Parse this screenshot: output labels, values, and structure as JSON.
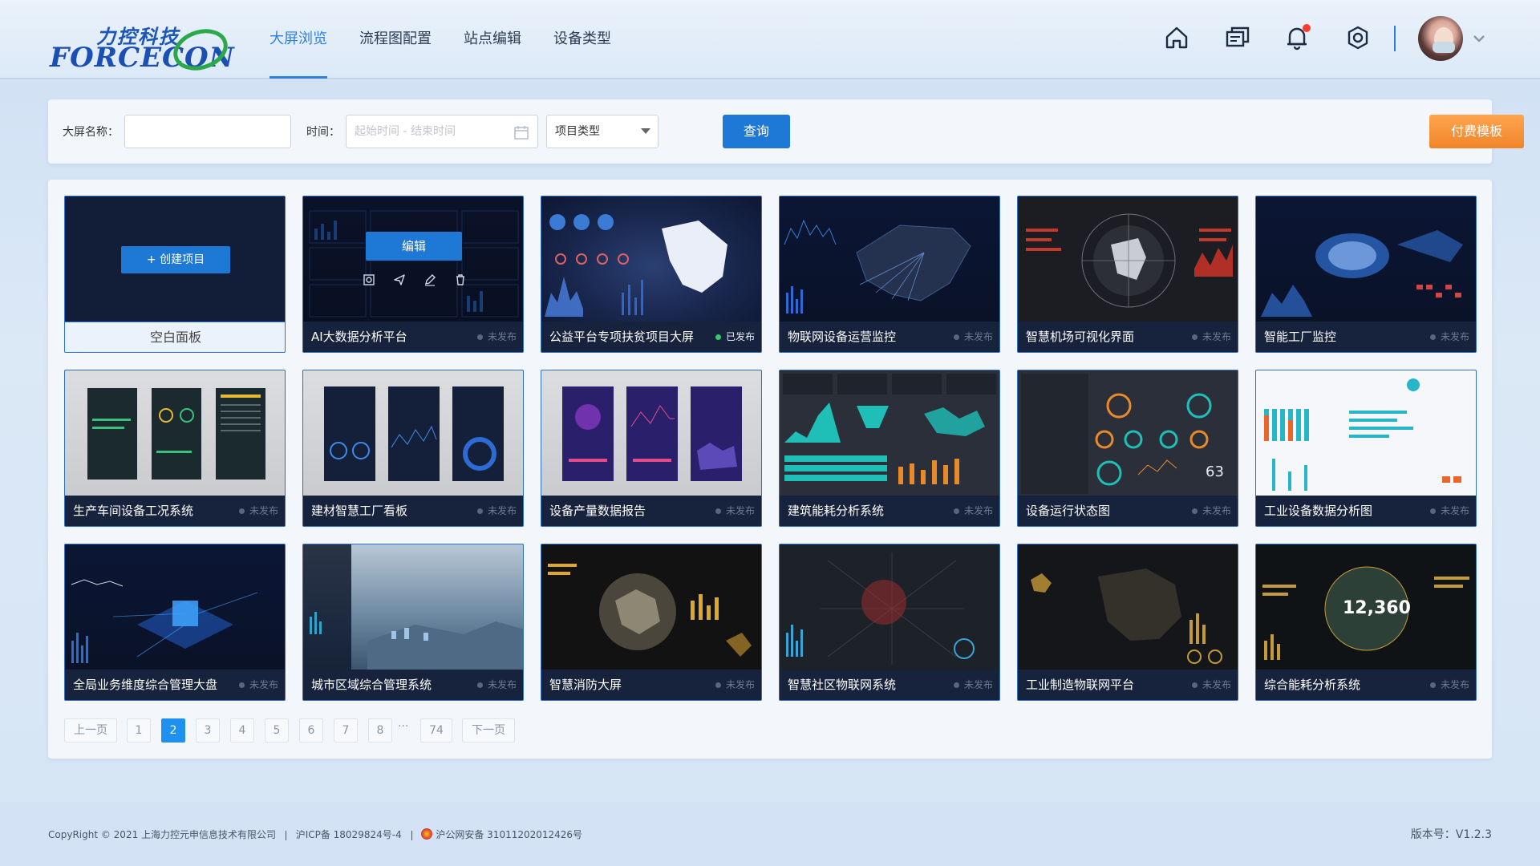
{
  "app": {
    "logo_cn": "力控科技",
    "logo_en": "FORCECON"
  },
  "nav": {
    "items": [
      {
        "label": "大屏浏览",
        "active": true
      },
      {
        "label": "流程图配置",
        "active": false
      },
      {
        "label": "站点编辑",
        "active": false
      },
      {
        "label": "设备类型",
        "active": false
      }
    ]
  },
  "header_icons": [
    "home-icon",
    "messages-icon",
    "bell-icon",
    "settings-icon"
  ],
  "filter": {
    "name_label": "大屏名称：",
    "name_value": "",
    "time_label": "时间：",
    "time_placeholder": "起始时间 - 结束时间",
    "type_select": "项目类型",
    "query_label": "查询",
    "paid_template_label": "付费模板"
  },
  "blank_card": {
    "create_label": "+ 创建项目",
    "title": "空白面板"
  },
  "edit_overlay": {
    "edit_label": "编辑"
  },
  "status": {
    "published": "已发布",
    "unpublished": "未发布"
  },
  "projects": [
    {
      "title": "AI大数据分析平台",
      "status": "未发布"
    },
    {
      "title": "公益平台专项扶贫项目大屏",
      "status": "已发布"
    },
    {
      "title": "物联网设备运营监控",
      "status": "未发布"
    },
    {
      "title": "智慧机场可视化界面",
      "status": "未发布"
    },
    {
      "title": "智能工厂监控",
      "status": "未发布"
    },
    {
      "title": "生产车间设备工况系统",
      "status": "未发布"
    },
    {
      "title": "建材智慧工厂看板",
      "status": "未发布"
    },
    {
      "title": "设备产量数据报告",
      "status": "未发布"
    },
    {
      "title": "建筑能耗分析系统",
      "status": "未发布"
    },
    {
      "title": "设备运行状态图",
      "status": "未发布"
    },
    {
      "title": "工业设备数据分析图",
      "status": "未发布"
    },
    {
      "title": "全局业务维度综合管理大盘",
      "status": "未发布"
    },
    {
      "title": "城市区域综合管理系统",
      "status": "未发布"
    },
    {
      "title": "智慧消防大屏",
      "status": "未发布"
    },
    {
      "title": "智慧社区物联网系统",
      "status": "未发布"
    },
    {
      "title": "工业制造物联网平台",
      "status": "未发布"
    },
    {
      "title": "综合能耗分析系统",
      "status": "未发布"
    }
  ],
  "pagination": {
    "prev": "上一页",
    "next": "下一页",
    "pages": [
      "1",
      "2",
      "3",
      "4",
      "5",
      "6",
      "7",
      "8"
    ],
    "current": "2",
    "ellipsis": "···",
    "last": "74"
  },
  "footer": {
    "copyright": "CopyRight © 2021 上海力控元申信息技术有限公司",
    "icp": "沪ICP备 18029824号-4",
    "police": "沪公网安备 31011202012426号",
    "version": "版本号：V1.2.3"
  },
  "colors": {
    "primary": "#1e78d6",
    "nav_active": "#2f7fe0",
    "pay_button": "#f0852a",
    "published_dot": "#2ecc71"
  }
}
